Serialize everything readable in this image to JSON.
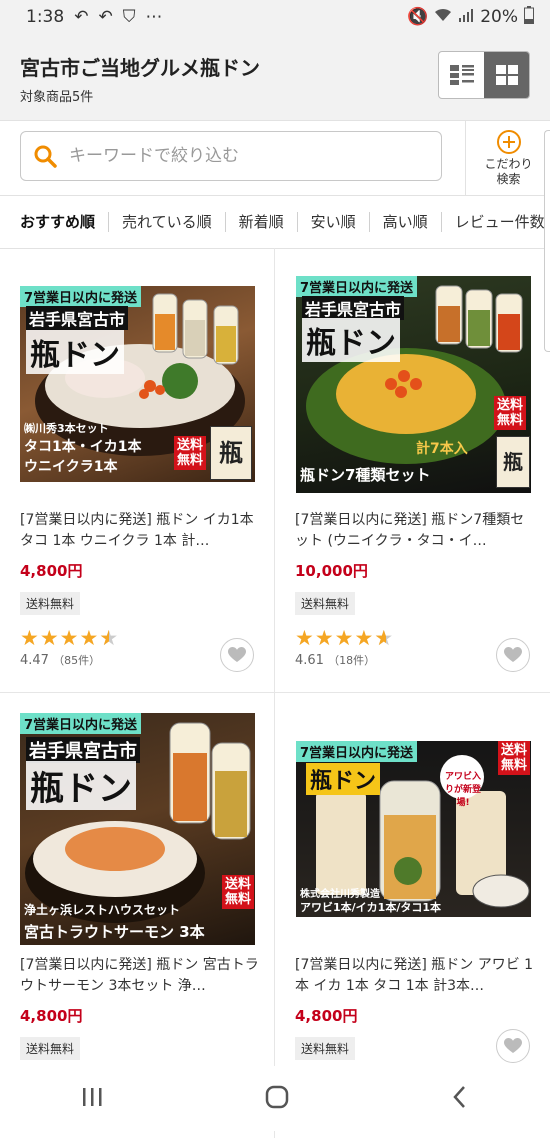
{
  "status": {
    "time": "1:38",
    "battery": "20%"
  },
  "header": {
    "title": "宮古市ご当地グルメ瓶ドン",
    "subtitle": "対象商品5件"
  },
  "search": {
    "placeholder": "キーワードで絞り込む",
    "filter_label_1": "こだわり",
    "filter_label_2": "検索"
  },
  "sort": [
    "おすすめ順",
    "売れている順",
    "新着順",
    "安い順",
    "高い順",
    "レビュー件数順"
  ],
  "products": [
    {
      "title": "[7営業日以内に発送] 瓶ドン イカ1本 タコ 1本 ウニイクラ 1本 計…",
      "price": "4,800円",
      "shipping": "送料無料",
      "rating": "4.47",
      "reviews": "（85件）",
      "img": {
        "top_banner": "7営業日以内に発送",
        "place": "岩手県宮古市",
        "brand": "瓶ドン",
        "maker": "㈱川秀3本セット",
        "line1": "タコ1本・イカ1本",
        "line2": "ウニイクラ1本",
        "badge1": "送料",
        "badge2": "無料"
      }
    },
    {
      "title": "[7営業日以内に発送] 瓶ドン7種類セット (ウニイクラ・タコ・イ…",
      "price": "10,000円",
      "shipping": "送料無料",
      "rating": "4.61",
      "reviews": "（18件）",
      "img": {
        "top_banner": "7営業日以内に発送",
        "place": "岩手県宮古市",
        "brand": "瓶ドン",
        "count": "計7本入",
        "bottom": "瓶ドン7種類セット",
        "badge1": "送料",
        "badge2": "無料"
      }
    },
    {
      "title": "[7営業日以内に発送] 瓶ドン 宮古トラウトサーモン 3本セット 浄…",
      "price": "4,800円",
      "shipping": "送料無料",
      "img": {
        "top_banner": "7営業日以内に発送",
        "place": "岩手県宮古市",
        "brand": "瓶ドン",
        "line1": "浄土ヶ浜レストハウスセット",
        "line2": "宮古トラウトサーモン 3本",
        "badge1": "送料",
        "badge2": "無料"
      }
    },
    {
      "title": "[7営業日以内に発送] 瓶ドン アワビ 1本 イカ 1本 タコ 1本 計3本…",
      "price": "4,800円",
      "shipping": "送料無料",
      "img": {
        "top_banner": "7営業日以内に発送",
        "brand": "瓶ドン",
        "note": "アワビ入りが新登場!",
        "maker": "株式会社川秀製造",
        "line1": "アワビ1本/イカ1本/タコ1本",
        "badge1": "送料",
        "badge2": "無料"
      }
    }
  ],
  "colors": {
    "accent": "#f08c00",
    "price": "#c4001a",
    "star": "#f5a623"
  }
}
